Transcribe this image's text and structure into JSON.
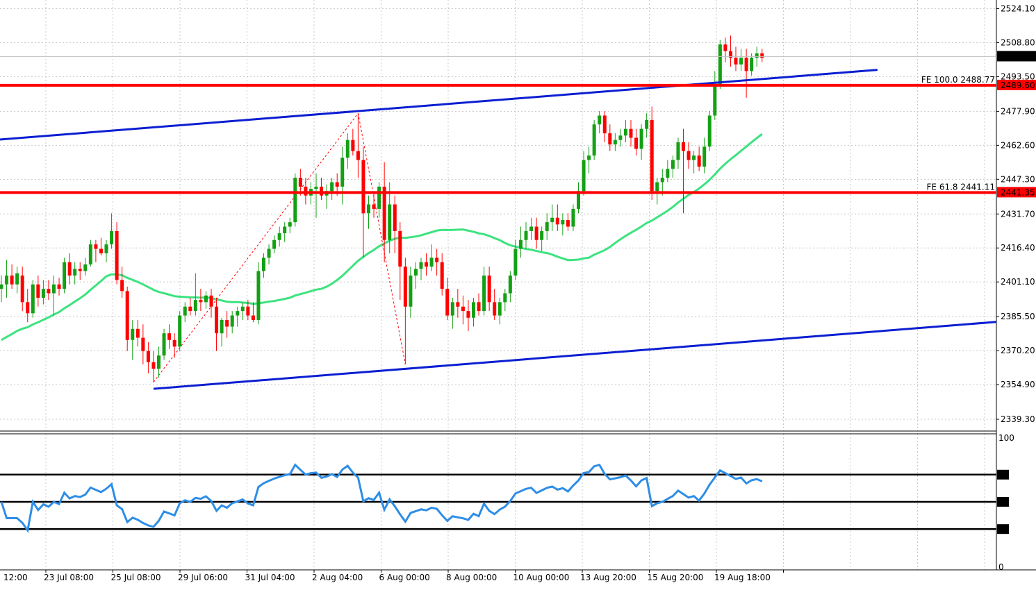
{
  "chart_data": {
    "type": "candlestick",
    "price_axis": {
      "ticks": [
        "2524.10",
        "2508.80",
        "2493.50",
        "2477.90",
        "2462.60",
        "2447.30",
        "2431.70",
        "2416.40",
        "2401.10",
        "2385.50",
        "2370.20",
        "2354.90",
        "2339.30"
      ],
      "current_price": "2502.56",
      "ylim": [
        2334,
        2528
      ]
    },
    "time_axis": {
      "ticks": [
        "12:00",
        "23 Jul 08:00",
        "25 Jul 08:00",
        "29 Jul 06:00",
        "31 Jul 04:00",
        "2 Aug 04:00",
        "6 Aug 00:00",
        "8 Aug 00:00",
        "10 Aug 00:00",
        "13 Aug 20:00",
        "15 Aug 20:00",
        "19 Aug 18:00"
      ]
    },
    "horizontal_levels": [
      {
        "label": "FE 100.0 2488.77",
        "tag": "2489.60",
        "value": 2489.6,
        "color": "#ff0000"
      },
      {
        "label": "FE 61.8 2441.11",
        "tag": "2441.35",
        "value": 2441.35,
        "color": "#ff0000"
      }
    ],
    "channel": {
      "color": "#0b1fd1"
    },
    "ma_color": "#3be37f",
    "up_color": "#14a014",
    "down_color": "#ff0000",
    "candles": [
      {
        "o": 2398,
        "h": 2404,
        "l": 2392,
        "c": 2400
      },
      {
        "o": 2400,
        "h": 2411,
        "l": 2394,
        "c": 2404
      },
      {
        "o": 2404,
        "h": 2409,
        "l": 2398,
        "c": 2400
      },
      {
        "o": 2400,
        "h": 2408,
        "l": 2396,
        "c": 2405
      },
      {
        "o": 2404,
        "h": 2408,
        "l": 2388,
        "c": 2392
      },
      {
        "o": 2392,
        "h": 2398,
        "l": 2383,
        "c": 2387
      },
      {
        "o": 2387,
        "h": 2402,
        "l": 2385,
        "c": 2400
      },
      {
        "o": 2400,
        "h": 2404,
        "l": 2390,
        "c": 2394
      },
      {
        "o": 2394,
        "h": 2402,
        "l": 2391,
        "c": 2398
      },
      {
        "o": 2398,
        "h": 2402,
        "l": 2393,
        "c": 2396
      },
      {
        "o": 2396,
        "h": 2404,
        "l": 2386,
        "c": 2400
      },
      {
        "o": 2400,
        "h": 2403,
        "l": 2395,
        "c": 2398
      },
      {
        "o": 2398,
        "h": 2412,
        "l": 2396,
        "c": 2410
      },
      {
        "o": 2410,
        "h": 2414,
        "l": 2400,
        "c": 2404
      },
      {
        "o": 2404,
        "h": 2410,
        "l": 2400,
        "c": 2407
      },
      {
        "o": 2407,
        "h": 2410,
        "l": 2402,
        "c": 2406
      },
      {
        "o": 2406,
        "h": 2412,
        "l": 2404,
        "c": 2409
      },
      {
        "o": 2409,
        "h": 2420,
        "l": 2408,
        "c": 2418
      },
      {
        "o": 2418,
        "h": 2420,
        "l": 2410,
        "c": 2416
      },
      {
        "o": 2416,
        "h": 2421,
        "l": 2413,
        "c": 2414
      },
      {
        "o": 2414,
        "h": 2420,
        "l": 2410,
        "c": 2418
      },
      {
        "o": 2418,
        "h": 2432,
        "l": 2416,
        "c": 2424
      },
      {
        "o": 2424,
        "h": 2428,
        "l": 2400,
        "c": 2402
      },
      {
        "o": 2402,
        "h": 2408,
        "l": 2394,
        "c": 2397
      },
      {
        "o": 2397,
        "h": 2399,
        "l": 2370,
        "c": 2375
      },
      {
        "o": 2375,
        "h": 2384,
        "l": 2366,
        "c": 2380
      },
      {
        "o": 2380,
        "h": 2384,
        "l": 2372,
        "c": 2376
      },
      {
        "o": 2376,
        "h": 2382,
        "l": 2364,
        "c": 2370
      },
      {
        "o": 2370,
        "h": 2374,
        "l": 2360,
        "c": 2365
      },
      {
        "o": 2365,
        "h": 2370,
        "l": 2356,
        "c": 2362
      },
      {
        "o": 2362,
        "h": 2372,
        "l": 2358,
        "c": 2368
      },
      {
        "o": 2368,
        "h": 2380,
        "l": 2366,
        "c": 2378
      },
      {
        "o": 2378,
        "h": 2382,
        "l": 2371,
        "c": 2375
      },
      {
        "o": 2375,
        "h": 2378,
        "l": 2367,
        "c": 2372
      },
      {
        "o": 2372,
        "h": 2388,
        "l": 2370,
        "c": 2386
      },
      {
        "o": 2386,
        "h": 2392,
        "l": 2383,
        "c": 2390
      },
      {
        "o": 2390,
        "h": 2394,
        "l": 2386,
        "c": 2388
      },
      {
        "o": 2388,
        "h": 2405,
        "l": 2386,
        "c": 2393
      },
      {
        "o": 2393,
        "h": 2398,
        "l": 2388,
        "c": 2392
      },
      {
        "o": 2392,
        "h": 2397,
        "l": 2389,
        "c": 2395
      },
      {
        "o": 2395,
        "h": 2398,
        "l": 2385,
        "c": 2390
      },
      {
        "o": 2390,
        "h": 2394,
        "l": 2370,
        "c": 2378
      },
      {
        "o": 2378,
        "h": 2385,
        "l": 2372,
        "c": 2384
      },
      {
        "o": 2384,
        "h": 2388,
        "l": 2376,
        "c": 2381
      },
      {
        "o": 2381,
        "h": 2388,
        "l": 2378,
        "c": 2386
      },
      {
        "o": 2386,
        "h": 2390,
        "l": 2381,
        "c": 2388
      },
      {
        "o": 2388,
        "h": 2392,
        "l": 2384,
        "c": 2390
      },
      {
        "o": 2390,
        "h": 2393,
        "l": 2384,
        "c": 2386
      },
      {
        "o": 2386,
        "h": 2392,
        "l": 2383,
        "c": 2384
      },
      {
        "o": 2384,
        "h": 2410,
        "l": 2382,
        "c": 2406
      },
      {
        "o": 2406,
        "h": 2414,
        "l": 2403,
        "c": 2412
      },
      {
        "o": 2412,
        "h": 2418,
        "l": 2409,
        "c": 2416
      },
      {
        "o": 2416,
        "h": 2422,
        "l": 2414,
        "c": 2420
      },
      {
        "o": 2420,
        "h": 2426,
        "l": 2417,
        "c": 2423
      },
      {
        "o": 2423,
        "h": 2428,
        "l": 2419,
        "c": 2426
      },
      {
        "o": 2426,
        "h": 2430,
        "l": 2423,
        "c": 2428
      },
      {
        "o": 2428,
        "h": 2450,
        "l": 2426,
        "c": 2448
      },
      {
        "o": 2448,
        "h": 2452,
        "l": 2440,
        "c": 2444
      },
      {
        "o": 2444,
        "h": 2448,
        "l": 2436,
        "c": 2440
      },
      {
        "o": 2440,
        "h": 2446,
        "l": 2436,
        "c": 2443
      },
      {
        "o": 2443,
        "h": 2450,
        "l": 2430,
        "c": 2444
      },
      {
        "o": 2444,
        "h": 2448,
        "l": 2438,
        "c": 2440
      },
      {
        "o": 2440,
        "h": 2445,
        "l": 2434,
        "c": 2442
      },
      {
        "o": 2442,
        "h": 2448,
        "l": 2438,
        "c": 2446
      },
      {
        "o": 2446,
        "h": 2450,
        "l": 2440,
        "c": 2444
      },
      {
        "o": 2444,
        "h": 2462,
        "l": 2436,
        "c": 2457
      },
      {
        "o": 2457,
        "h": 2468,
        "l": 2452,
        "c": 2465
      },
      {
        "o": 2465,
        "h": 2470,
        "l": 2458,
        "c": 2460
      },
      {
        "o": 2460,
        "h": 2477,
        "l": 2448,
        "c": 2456
      },
      {
        "o": 2456,
        "h": 2462,
        "l": 2412,
        "c": 2432
      },
      {
        "o": 2432,
        "h": 2440,
        "l": 2425,
        "c": 2436
      },
      {
        "o": 2436,
        "h": 2442,
        "l": 2430,
        "c": 2434
      },
      {
        "o": 2434,
        "h": 2446,
        "l": 2430,
        "c": 2444
      },
      {
        "o": 2444,
        "h": 2455,
        "l": 2410,
        "c": 2420
      },
      {
        "o": 2420,
        "h": 2446,
        "l": 2414,
        "c": 2436
      },
      {
        "o": 2436,
        "h": 2440,
        "l": 2414,
        "c": 2424
      },
      {
        "o": 2424,
        "h": 2428,
        "l": 2393,
        "c": 2408
      },
      {
        "o": 2408,
        "h": 2412,
        "l": 2364,
        "c": 2390
      },
      {
        "o": 2390,
        "h": 2408,
        "l": 2385,
        "c": 2404
      },
      {
        "o": 2404,
        "h": 2410,
        "l": 2398,
        "c": 2407
      },
      {
        "o": 2407,
        "h": 2412,
        "l": 2402,
        "c": 2410
      },
      {
        "o": 2410,
        "h": 2414,
        "l": 2404,
        "c": 2408
      },
      {
        "o": 2408,
        "h": 2418,
        "l": 2406,
        "c": 2412
      },
      {
        "o": 2412,
        "h": 2416,
        "l": 2404,
        "c": 2410
      },
      {
        "o": 2410,
        "h": 2414,
        "l": 2395,
        "c": 2398
      },
      {
        "o": 2398,
        "h": 2403,
        "l": 2384,
        "c": 2386
      },
      {
        "o": 2386,
        "h": 2394,
        "l": 2380,
        "c": 2392
      },
      {
        "o": 2392,
        "h": 2398,
        "l": 2385,
        "c": 2390
      },
      {
        "o": 2390,
        "h": 2395,
        "l": 2382,
        "c": 2388
      },
      {
        "o": 2388,
        "h": 2393,
        "l": 2379,
        "c": 2385
      },
      {
        "o": 2385,
        "h": 2394,
        "l": 2381,
        "c": 2392
      },
      {
        "o": 2392,
        "h": 2396,
        "l": 2386,
        "c": 2388
      },
      {
        "o": 2388,
        "h": 2408,
        "l": 2386,
        "c": 2404
      },
      {
        "o": 2404,
        "h": 2408,
        "l": 2388,
        "c": 2392
      },
      {
        "o": 2392,
        "h": 2398,
        "l": 2384,
        "c": 2386
      },
      {
        "o": 2386,
        "h": 2394,
        "l": 2382,
        "c": 2392
      },
      {
        "o": 2392,
        "h": 2398,
        "l": 2388,
        "c": 2396
      },
      {
        "o": 2396,
        "h": 2406,
        "l": 2392,
        "c": 2404
      },
      {
        "o": 2404,
        "h": 2420,
        "l": 2402,
        "c": 2416
      },
      {
        "o": 2416,
        "h": 2426,
        "l": 2412,
        "c": 2420
      },
      {
        "o": 2420,
        "h": 2428,
        "l": 2416,
        "c": 2424
      },
      {
        "o": 2424,
        "h": 2430,
        "l": 2420,
        "c": 2426
      },
      {
        "o": 2426,
        "h": 2430,
        "l": 2416,
        "c": 2420
      },
      {
        "o": 2420,
        "h": 2426,
        "l": 2415,
        "c": 2424
      },
      {
        "o": 2424,
        "h": 2432,
        "l": 2420,
        "c": 2428
      },
      {
        "o": 2428,
        "h": 2436,
        "l": 2424,
        "c": 2430
      },
      {
        "o": 2430,
        "h": 2436,
        "l": 2424,
        "c": 2427
      },
      {
        "o": 2427,
        "h": 2432,
        "l": 2422,
        "c": 2429
      },
      {
        "o": 2429,
        "h": 2432,
        "l": 2424,
        "c": 2426
      },
      {
        "o": 2426,
        "h": 2436,
        "l": 2424,
        "c": 2434
      },
      {
        "o": 2434,
        "h": 2446,
        "l": 2432,
        "c": 2442
      },
      {
        "o": 2442,
        "h": 2460,
        "l": 2440,
        "c": 2456
      },
      {
        "o": 2456,
        "h": 2462,
        "l": 2450,
        "c": 2458
      },
      {
        "o": 2458,
        "h": 2474,
        "l": 2456,
        "c": 2472
      },
      {
        "o": 2472,
        "h": 2478,
        "l": 2468,
        "c": 2476
      },
      {
        "o": 2476,
        "h": 2478,
        "l": 2464,
        "c": 2468
      },
      {
        "o": 2468,
        "h": 2472,
        "l": 2460,
        "c": 2463
      },
      {
        "o": 2463,
        "h": 2468,
        "l": 2460,
        "c": 2465
      },
      {
        "o": 2465,
        "h": 2470,
        "l": 2462,
        "c": 2467
      },
      {
        "o": 2467,
        "h": 2474,
        "l": 2464,
        "c": 2470
      },
      {
        "o": 2470,
        "h": 2474,
        "l": 2462,
        "c": 2466
      },
      {
        "o": 2466,
        "h": 2470,
        "l": 2458,
        "c": 2461
      },
      {
        "o": 2461,
        "h": 2472,
        "l": 2456,
        "c": 2470
      },
      {
        "o": 2470,
        "h": 2477,
        "l": 2466,
        "c": 2474
      },
      {
        "o": 2474,
        "h": 2480,
        "l": 2438,
        "c": 2442
      },
      {
        "o": 2442,
        "h": 2448,
        "l": 2436,
        "c": 2446
      },
      {
        "o": 2446,
        "h": 2452,
        "l": 2440,
        "c": 2448
      },
      {
        "o": 2448,
        "h": 2456,
        "l": 2446,
        "c": 2452
      },
      {
        "o": 2452,
        "h": 2458,
        "l": 2448,
        "c": 2456
      },
      {
        "o": 2456,
        "h": 2466,
        "l": 2452,
        "c": 2464
      },
      {
        "o": 2464,
        "h": 2470,
        "l": 2432,
        "c": 2460
      },
      {
        "o": 2460,
        "h": 2464,
        "l": 2452,
        "c": 2456
      },
      {
        "o": 2456,
        "h": 2460,
        "l": 2450,
        "c": 2458
      },
      {
        "o": 2458,
        "h": 2462,
        "l": 2451,
        "c": 2453
      },
      {
        "o": 2453,
        "h": 2466,
        "l": 2450,
        "c": 2462
      },
      {
        "o": 2462,
        "h": 2478,
        "l": 2460,
        "c": 2476
      },
      {
        "o": 2476,
        "h": 2496,
        "l": 2474,
        "c": 2490
      },
      {
        "o": 2490,
        "h": 2510,
        "l": 2488,
        "c": 2508
      },
      {
        "o": 2508,
        "h": 2511,
        "l": 2500,
        "c": 2505
      },
      {
        "o": 2505,
        "h": 2512,
        "l": 2498,
        "c": 2502
      },
      {
        "o": 2502,
        "h": 2507,
        "l": 2496,
        "c": 2499
      },
      {
        "o": 2499,
        "h": 2506,
        "l": 2496,
        "c": 2502
      },
      {
        "o": 2502,
        "h": 2506,
        "l": 2484,
        "c": 2496
      },
      {
        "o": 2496,
        "h": 2504,
        "l": 2494,
        "c": 2502
      },
      {
        "o": 2502,
        "h": 2507,
        "l": 2498,
        "c": 2504
      },
      {
        "o": 2504,
        "h": 2506,
        "l": 2500,
        "c": 2502
      }
    ],
    "indicator": {
      "type": "rsi",
      "ticks": [
        "100",
        "70",
        "50",
        "30",
        "0"
      ],
      "levels": [
        70,
        50,
        30
      ],
      "line_color": "#2e8de6",
      "ylim": [
        0,
        100
      ]
    }
  }
}
